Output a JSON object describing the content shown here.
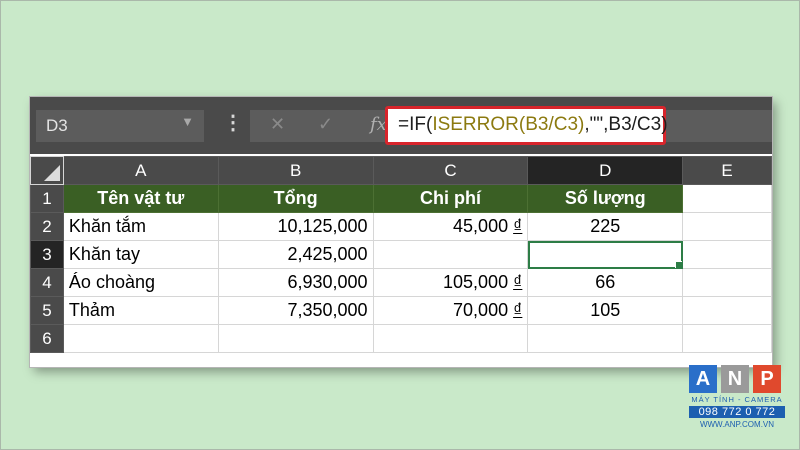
{
  "formula_bar": {
    "name_box": "D3",
    "name_box_chevron": "chevron-down-icon",
    "more_icon": "⋮",
    "cancel_icon": "✕",
    "enter_icon": "✓",
    "fx_label": "fx",
    "formula_prefix": "=IF(",
    "formula_highlight": "ISERROR(B3/C3)",
    "formula_suffix": ",\"\",B3/C3)"
  },
  "columns": [
    "A",
    "B",
    "C",
    "D",
    "E"
  ],
  "selected_column": "D",
  "selected_row": "3",
  "rows": [
    {
      "num": "1",
      "a": "Tên vật tư",
      "b": "Tổng",
      "c": "Chi phí",
      "d": "Số lượng"
    },
    {
      "num": "2",
      "a": "Khăn tắm",
      "b": "10,125,000",
      "c_value": "45,000",
      "c_currency": "₫",
      "d": "225"
    },
    {
      "num": "3",
      "a": "Khăn tay",
      "b": "2,425,000",
      "c_value": "",
      "c_currency": "",
      "d": ""
    },
    {
      "num": "4",
      "a": "Áo choàng",
      "b": "6,930,000",
      "c_value": "105,000",
      "c_currency": "₫",
      "d": "66"
    },
    {
      "num": "5",
      "a": "Thảm",
      "b": "7,350,000",
      "c_value": "70,000",
      "c_currency": "₫",
      "d": "105"
    },
    {
      "num": "6",
      "a": "",
      "b": "",
      "c_value": "",
      "c_currency": "",
      "d": ""
    }
  ],
  "colors": {
    "header_fill": "#3a5f24",
    "formula_highlight_box": "#d8252c",
    "active_cell": "#2d7d46",
    "background": "#c9e9c9"
  },
  "logo": {
    "letters": [
      "A",
      "N",
      "P"
    ],
    "tagline": "MÁY TÍNH - CAMERA",
    "phone": "098 772 0 772",
    "website": "WWW.ANP.COM.VN"
  }
}
